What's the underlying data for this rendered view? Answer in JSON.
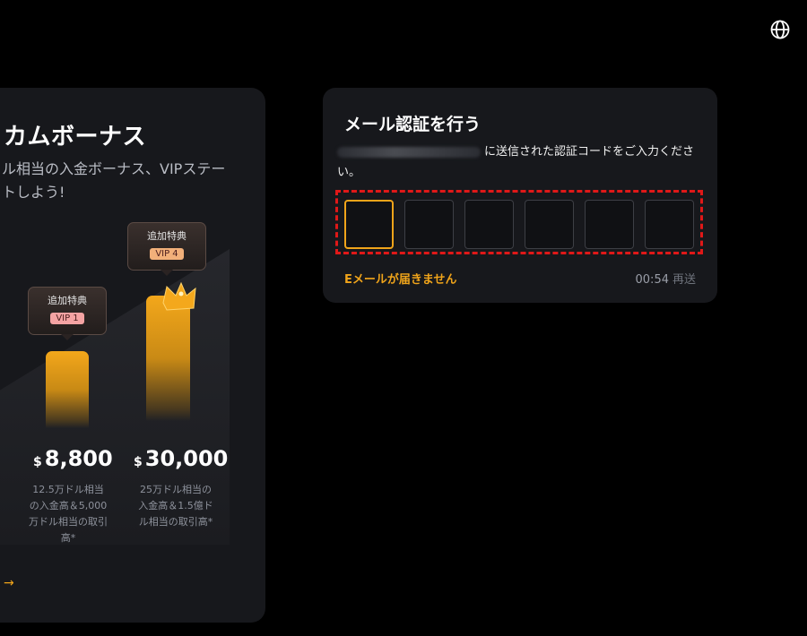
{
  "header": {
    "language_icon": "globe-icon"
  },
  "promo": {
    "title": "カムボーナス",
    "subtitle": "ル相当の入金ボーナス、VIPステー\nトしよう!",
    "tiers": [
      {
        "badge_title": "追加特典",
        "vip": "VIP 1",
        "vip_color": "#f4a3a3",
        "currency": "$",
        "amount": "8,800",
        "description": "12.5万ドル相当\nの入金高＆5,000\n万ドル相当の取引\n高*"
      },
      {
        "badge_title": "追加特典",
        "vip": "VIP 4",
        "vip_color": "#f2b07a",
        "currency": "$",
        "amount": "30,000",
        "description": "25万ドル相当の\n入金高＆1.5億ド\nル相当の取引高*"
      }
    ],
    "arrow_icon": "arrow-right-icon",
    "accent": "#f0a41a"
  },
  "verify": {
    "title": "メール認証を行う",
    "description": "に送信された認証コードをご入力ください。",
    "code_boxes": [
      "",
      "",
      "",
      "",
      "",
      ""
    ],
    "no_email": "Eメールが届きません",
    "timer": "00:54",
    "resend": "再送"
  }
}
